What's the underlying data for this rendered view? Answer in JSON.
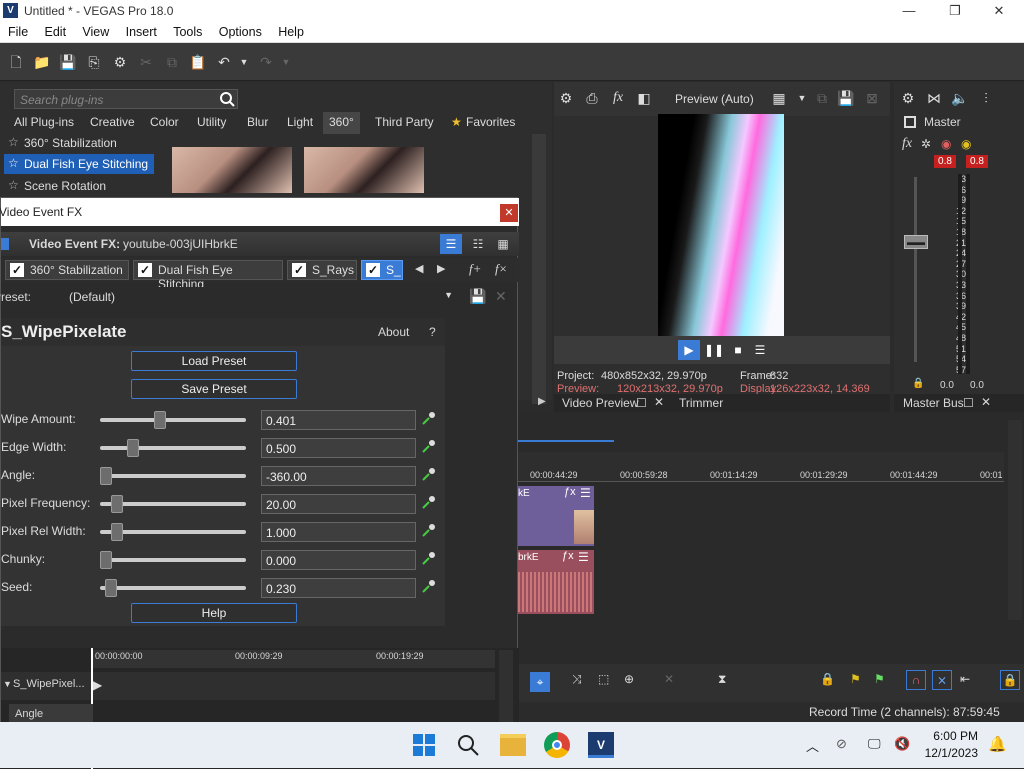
{
  "window": {
    "title": "Untitled * - VEGAS Pro 18.0",
    "logo": "V"
  },
  "menu": [
    "File",
    "Edit",
    "View",
    "Insert",
    "Tools",
    "Options",
    "Help"
  ],
  "plugins": {
    "search_placeholder": "Search plug-ins",
    "categories": [
      "All Plug-ins",
      "Creative",
      "Color",
      "Utility",
      "Blur",
      "Light",
      "360°",
      "Third Party",
      "Favorites"
    ],
    "selected_category": "360°",
    "items": [
      "360° Stabilization",
      "Dual Fish Eye Stitching",
      "Scene Rotation"
    ],
    "selected_item": "Dual Fish Eye Stitching"
  },
  "preview": {
    "mode": "Preview (Auto)",
    "project_label": "Project:",
    "project_val": "480x852x32, 29.970p",
    "frame_label": "Frame:",
    "frame_val": "832",
    "preview_label": "Preview:",
    "preview_val": "120x213x32, 29.970p",
    "display_label": "Display:",
    "display_val": "126x223x32, 14.369",
    "tab_video": "Video Preview",
    "tab_trimmer": "Trimmer"
  },
  "master": {
    "title": "Master",
    "level_l": "0.8",
    "level_r": "0.8",
    "scale": [
      "3",
      "6",
      "9",
      "12",
      "15",
      "18",
      "21",
      "24",
      "27",
      "30",
      "33",
      "36",
      "39",
      "42",
      "45",
      "48",
      "51",
      "54",
      "57"
    ],
    "out_l": "0.0",
    "out_r": "0.0",
    "tab": "Master Bus"
  },
  "dialog": {
    "title": "Video Event FX",
    "fx_label": "Video Event FX:",
    "fx_event": "youtube-003jUIHbrkE",
    "chain": [
      "360° Stabilization",
      "Dual Fish Eye Stitching",
      "S_Rays",
      "S_"
    ],
    "preset_label": "Preset:",
    "preset_value": "(Default)",
    "plugin_name": "S_WipePixelate",
    "about": "About",
    "help_q": "?",
    "load_preset": "Load Preset",
    "save_preset": "Save Preset",
    "help_btn": "Help",
    "params": [
      {
        "label": "Wipe Amount:",
        "value": "0.401",
        "pos": 0.401
      },
      {
        "label": "Edge Width:",
        "value": "0.500",
        "pos": 0.2
      },
      {
        "label": "Angle:",
        "value": "-360.00",
        "pos": 0.0
      },
      {
        "label": "Pixel Frequency:",
        "value": "20.00",
        "pos": 0.08
      },
      {
        "label": "Pixel Rel Width:",
        "value": "1.000",
        "pos": 0.08
      },
      {
        "label": "Chunky:",
        "value": "0.000",
        "pos": 0.0
      },
      {
        "label": "Seed:",
        "value": "0.230",
        "pos": 0.04
      }
    ],
    "env_times": [
      "00:00:00:00",
      "00:00:09:29",
      "00:00:19:29"
    ],
    "env_track": "S_WipePixel...",
    "env_param": "Angle"
  },
  "timeline": {
    "ruler": [
      "00:00:44:29",
      "00:00:59:28",
      "00:01:14:29",
      "00:01:29:29",
      "00:01:44:29",
      "00:01"
    ],
    "track1": "kE",
    "track2": "brkE",
    "record_time": "Record Time (2 channels): 87:59:45"
  },
  "taskbar": {
    "time": "6:00 PM",
    "date": "12/1/2023"
  }
}
